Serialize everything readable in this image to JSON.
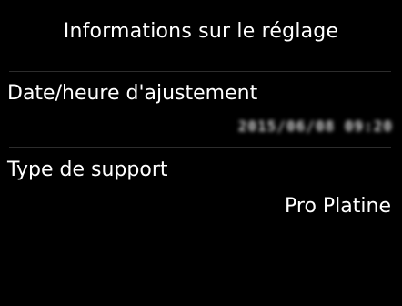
{
  "screen": {
    "title": "Informations sur le réglage"
  },
  "items": [
    {
      "label": "Date/heure d'ajustement",
      "value": "2015/06/08 09:20",
      "value_obscured": true
    },
    {
      "label": "Type de support",
      "value": "Pro Platine"
    }
  ],
  "colors": {
    "background": "#000000",
    "text": "#ffffff",
    "divider": "#2c2c2c"
  }
}
